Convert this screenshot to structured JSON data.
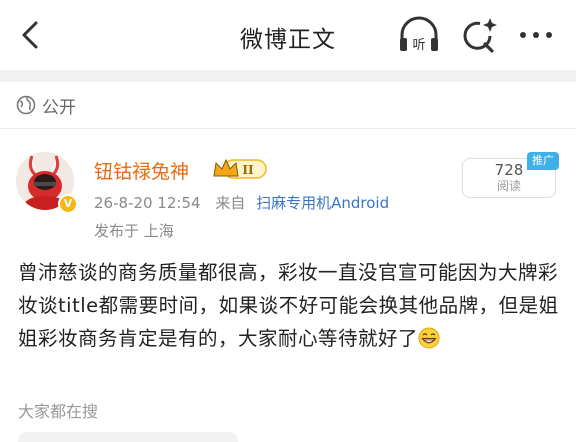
{
  "header": {
    "title": "微博正文",
    "listen_label": "听"
  },
  "visibility": {
    "label": "公开"
  },
  "post": {
    "author": "钮钴禄兔神",
    "level_badge": "II",
    "vip_badge": "V",
    "timestamp": "26-8-20 12:54",
    "source_prefix": "来自",
    "source_device": "扫麻专用机Android",
    "location": "发布于 上海",
    "read_count": "728",
    "read_label": "阅读",
    "promo_tag": "推广",
    "body": "曾沛慈谈的商务质量都很高，彩妆一直没官宣可能因为大牌彩妆谈title都需要时间，如果谈不好可能会换其他品牌，但是姐姐彩妆商务肯定是有的，大家耐心等待就好了"
  },
  "footer": {
    "search_hint": "大家都在搜"
  },
  "colors": {
    "accent_orange": "#e86a10",
    "link_blue": "#3b76c4",
    "promo_blue": "#3eb0e8",
    "vip_gold": "#f6b717"
  },
  "icons": [
    "back-arrow-icon",
    "headphones-icon",
    "search-sparkle-icon",
    "more-icon",
    "globe-icon",
    "grin-emoji-icon"
  ]
}
